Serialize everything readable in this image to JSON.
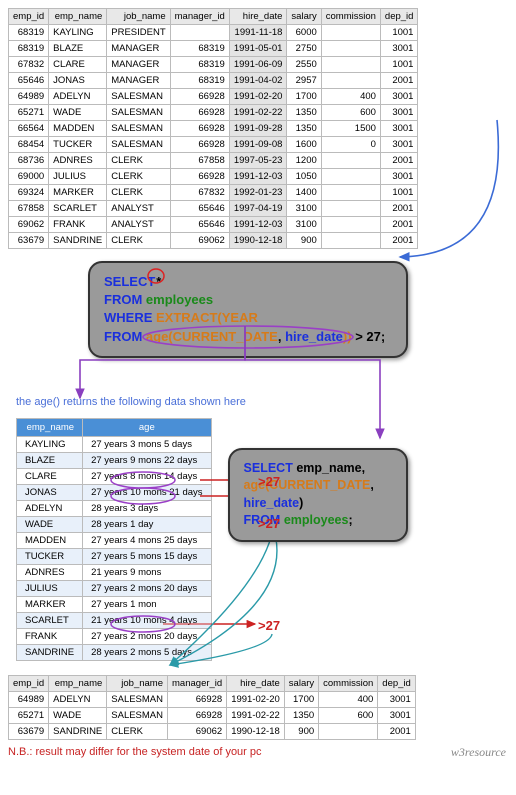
{
  "main_table": {
    "headers": [
      "emp_id",
      "emp_name",
      "job_name",
      "manager_id",
      "hire_date",
      "salary",
      "commission",
      "dep_id"
    ],
    "rows": [
      [
        "68319",
        "KAYLING",
        "PRESIDENT",
        "",
        "1991-11-18",
        "6000",
        "",
        "1001"
      ],
      [
        "68319",
        "BLAZE",
        "MANAGER",
        "68319",
        "1991-05-01",
        "2750",
        "",
        "3001"
      ],
      [
        "67832",
        "CLARE",
        "MANAGER",
        "68319",
        "1991-06-09",
        "2550",
        "",
        "1001"
      ],
      [
        "65646",
        "JONAS",
        "MANAGER",
        "68319",
        "1991-04-02",
        "2957",
        "",
        "2001"
      ],
      [
        "64989",
        "ADELYN",
        "SALESMAN",
        "66928",
        "1991-02-20",
        "1700",
        "400",
        "3001"
      ],
      [
        "65271",
        "WADE",
        "SALESMAN",
        "66928",
        "1991-02-22",
        "1350",
        "600",
        "3001"
      ],
      [
        "66564",
        "MADDEN",
        "SALESMAN",
        "66928",
        "1991-09-28",
        "1350",
        "1500",
        "3001"
      ],
      [
        "68454",
        "TUCKER",
        "SALESMAN",
        "66928",
        "1991-09-08",
        "1600",
        "0",
        "3001"
      ],
      [
        "68736",
        "ADNRES",
        "CLERK",
        "67858",
        "1997-05-23",
        "1200",
        "",
        "2001"
      ],
      [
        "69000",
        "JULIUS",
        "CLERK",
        "66928",
        "1991-12-03",
        "1050",
        "",
        "3001"
      ],
      [
        "69324",
        "MARKER",
        "CLERK",
        "67832",
        "1992-01-23",
        "1400",
        "",
        "1001"
      ],
      [
        "67858",
        "SCARLET",
        "ANALYST",
        "65646",
        "1997-04-19",
        "3100",
        "",
        "2001"
      ],
      [
        "69062",
        "FRANK",
        "ANALYST",
        "65646",
        "1991-12-03",
        "3100",
        "",
        "2001"
      ],
      [
        "63679",
        "SANDRINE",
        "CLERK",
        "69062",
        "1990-12-18",
        "900",
        "",
        "2001"
      ]
    ]
  },
  "sql1": {
    "select": "SELECT",
    "star": "*",
    "from": "FROM",
    "employees": "employees",
    "where": "WHERE",
    "extract": "EXTRACT(YEAR",
    "from2": "FROM",
    "age_open": "age(",
    "curdate": "CURRENT_DATE",
    "comma": ", ",
    "hiredate": "hire_date",
    "close": "))",
    "gt": " > 27;"
  },
  "sql2": {
    "select": "SELECT",
    "empname": " emp_name,",
    "agefn": "age(",
    "curdate": "CURRENT_DATE",
    "comma": ",",
    "hiredate": "hire_date",
    "close": ")",
    "from": "FROM",
    "employees": " employees",
    "semi": ";"
  },
  "annot_text": "the age() returns the following data shown here",
  "age_table": {
    "headers": [
      "emp_name",
      "age"
    ],
    "rows": [
      [
        "KAYLING",
        "27 years 3 mons 5 days"
      ],
      [
        "BLAZE",
        "27 years 9 mons 22 days"
      ],
      [
        "CLARE",
        "27 years 8 mons 14 days"
      ],
      [
        "JONAS",
        "27 years 10 mons 21 days"
      ],
      [
        "ADELYN",
        "28 years 3 days"
      ],
      [
        "WADE",
        "28 years 1 day"
      ],
      [
        "MADDEN",
        "27 years 4 mons 25 days"
      ],
      [
        "TUCKER",
        "27 years 5 mons 15 days"
      ],
      [
        "ADNRES",
        "21 years 9 mons"
      ],
      [
        "JULIUS",
        "27 years 2 mons 20 days"
      ],
      [
        "MARKER",
        "27 years 1 mon"
      ],
      [
        "SCARLET",
        "21 years 10 mons 4 days"
      ],
      [
        "FRANK",
        "27 years 2 mons 20 days"
      ],
      [
        "SANDRINE",
        "28 years 2 mons 5 days"
      ]
    ]
  },
  "gt27_label": ">27",
  "result_table": {
    "headers": [
      "emp_id",
      "emp_name",
      "job_name",
      "manager_id",
      "hire_date",
      "salary",
      "commission",
      "dep_id"
    ],
    "rows": [
      [
        "64989",
        "ADELYN",
        "SALESMAN",
        "66928",
        "1991-02-20",
        "1700",
        "400",
        "3001"
      ],
      [
        "65271",
        "WADE",
        "SALESMAN",
        "66928",
        "1991-02-22",
        "1350",
        "600",
        "3001"
      ],
      [
        "63679",
        "SANDRINE",
        "CLERK",
        "69062",
        "1990-12-18",
        "900",
        "",
        "2001"
      ]
    ]
  },
  "footer": "N.B.: result may differ for the system date of your pc",
  "watermark": "w3resource"
}
